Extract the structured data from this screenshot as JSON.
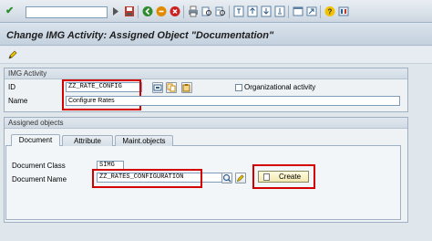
{
  "window": {
    "title": "Change IMG Activity: Assigned Object \"Documentation\""
  },
  "toolbar": {
    "command_field_value": "",
    "icons": [
      "enter-check",
      "command-dropdown",
      "back",
      "save",
      "back-nav",
      "exit",
      "cancel",
      "print",
      "find",
      "find-next",
      "first-page",
      "prev-page",
      "next-page",
      "last-page",
      "new-session",
      "shortcut",
      "help",
      "customize-layout"
    ]
  },
  "app_toolbar": {
    "icons": [
      "display-change-pencil"
    ]
  },
  "img_activity": {
    "group_title": "IMG Activity",
    "id_label": "ID",
    "id_value": "ZZ_RATE_CONFIG",
    "name_label": "Name",
    "name_value": "Configure Rates",
    "org_activity_label": "Organizational activity",
    "org_activity_checked": false
  },
  "assigned_objects": {
    "group_title": "Assigned objects",
    "tabs": [
      {
        "label": "Document",
        "active": true
      },
      {
        "label": "Attribute",
        "active": false
      },
      {
        "label": "Maint.objects",
        "active": false
      }
    ],
    "document_class_label": "Document Class",
    "document_class_value": "SIMG",
    "document_name_label": "Document Name",
    "document_name_value": "ZZ_RATES_CONFIGURATION",
    "create_button_label": "Create"
  },
  "colors": {
    "highlight": "#d40000",
    "background": "#dfe6ec",
    "create_button": "#f2e9b0"
  }
}
